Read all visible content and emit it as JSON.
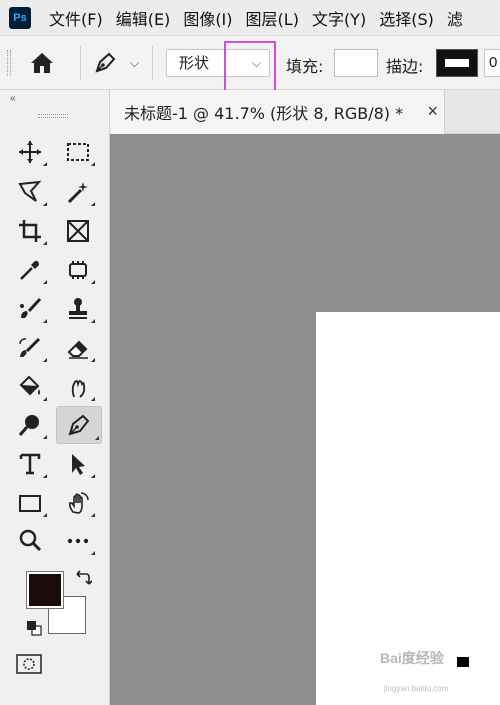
{
  "app": {
    "logo": "Ps"
  },
  "menu": {
    "items": [
      "文件(F)",
      "编辑(E)",
      "图像(I)",
      "图层(L)",
      "文字(Y)",
      "选择(S)",
      "滤"
    ]
  },
  "options": {
    "mode_value": "形状",
    "fill_label": "填充:",
    "stroke_label": "描边:",
    "stroke_width": "0",
    "fill_color": "#ffffff",
    "stroke_color": "#111111",
    "highlight_color": "#d14ed8"
  },
  "toolbar": {
    "collapse": "‹‹",
    "tools": [
      "move-icon",
      "marquee-icon",
      "lasso-icon",
      "magic-wand-icon",
      "crop-icon",
      "frame-icon",
      "eyedropper-icon",
      "patch-icon",
      "brush-icon",
      "stamp-icon",
      "history-brush-icon",
      "eraser-icon",
      "paint-bucket-icon",
      "smudge-icon",
      "dodge-icon",
      "pen-icon",
      "type-icon",
      "path-select-icon",
      "rectangle-icon",
      "hand-icon",
      "zoom-icon",
      "more-icon"
    ],
    "active_tool": "pen-icon",
    "foreground_color": "#1a0a09",
    "background_color": "#ffffff"
  },
  "document": {
    "tab_title": "未标题-1 @ 41.7% (形状 8, RGB/8) *",
    "close": "×"
  },
  "workspace": {
    "background": "#8e8e8e",
    "artboard_color": "#ffffff"
  },
  "watermark": {
    "text": "Bai度经验",
    "url": "jingyan.baidu.com"
  }
}
